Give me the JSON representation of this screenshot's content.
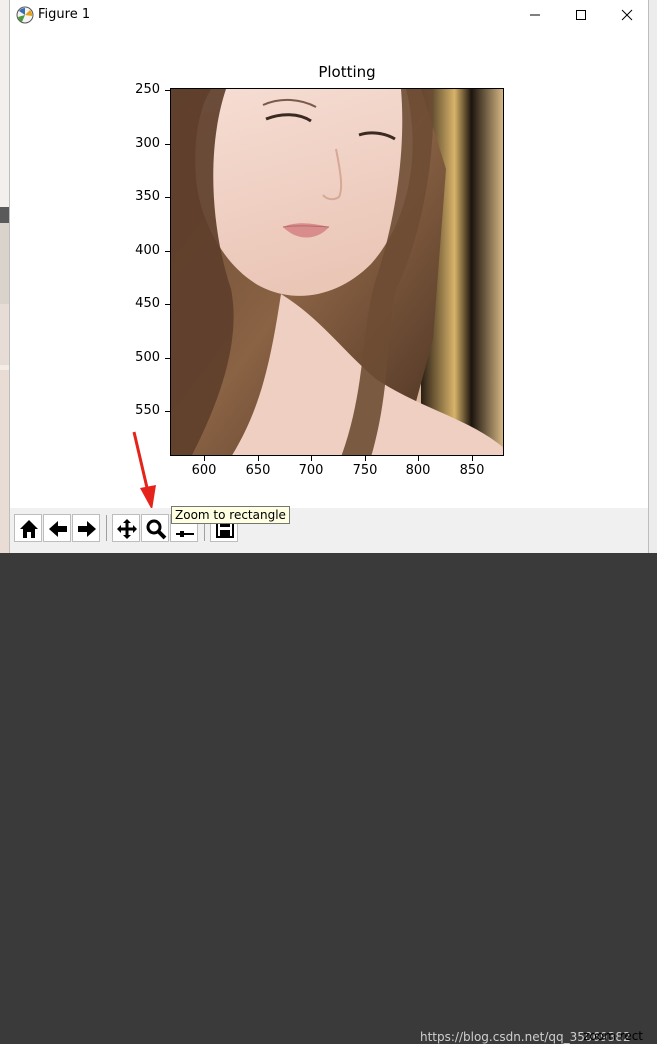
{
  "window": {
    "title": "Figure 1",
    "controls": {
      "minimize": "minimize",
      "maximize": "maximize",
      "close": "close"
    }
  },
  "figure": {
    "title": "Plotting",
    "y_ticks": [
      "250",
      "300",
      "350",
      "400",
      "450",
      "500",
      "550"
    ],
    "x_ticks": [
      "600",
      "650",
      "700",
      "750",
      "800",
      "850"
    ],
    "image": "photo of a woman with long brown hair, head tilted, eyes looking down"
  },
  "toolbar": {
    "buttons": [
      "home-icon",
      "back-arrow-icon",
      "forward-arrow-icon",
      "pan-icon",
      "zoom-icon",
      "subplots-icon",
      "save-icon"
    ],
    "tooltip": "Zoom to rectangle",
    "mode": "zoom rect",
    "watermark": "https://blog.csdn.net/qq_35069382"
  },
  "colors": {
    "accent_arrow": "#e5231b",
    "tooltip_bg": "#ffffe1",
    "toolbar_bg": "#f0f0f0"
  }
}
